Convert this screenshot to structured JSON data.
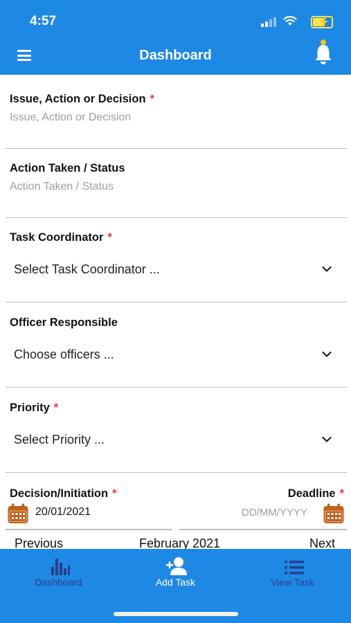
{
  "status_bar": {
    "time": "4:57"
  },
  "header": {
    "title": "Dashboard"
  },
  "form": {
    "issue": {
      "label": "Issue, Action or Decision",
      "required": "*",
      "placeholder": "Issue, Action or Decision"
    },
    "action": {
      "label": "Action Taken / Status",
      "placeholder": "Action Taken / Status"
    },
    "coordinator": {
      "label": "Task Coordinator",
      "required": "*",
      "value": "Select Task Coordinator ..."
    },
    "officer": {
      "label": "Officer Responsible",
      "value": "Choose officers ..."
    },
    "priority": {
      "label": "Priority",
      "required": "*",
      "value": "Select Priority ..."
    },
    "decision_date": {
      "label": "Decision/Initiation",
      "required": "*",
      "value": "20/01/2021"
    },
    "deadline": {
      "label": "Deadline",
      "required": "*",
      "placeholder": "DD/MM/YYYY"
    }
  },
  "calendar": {
    "prev": "Previous",
    "month": "February 2021",
    "next": "Next"
  },
  "tabbar": {
    "tabs": [
      {
        "label": "Dashboard",
        "icon": "bar-chart-icon"
      },
      {
        "label": "Add Task",
        "icon": "add-user-icon"
      },
      {
        "label": "View Task",
        "icon": "list-icon"
      }
    ]
  },
  "colors": {
    "primary": "#1e88e5",
    "required": "#e53935",
    "calendar_icon": "#c0601a",
    "tab_inactive": "#2c3e8c",
    "tab_active": "#ffffff",
    "bell": "#ffffff",
    "bell_accent": "#f5c518",
    "battery": "#ffe34d"
  }
}
